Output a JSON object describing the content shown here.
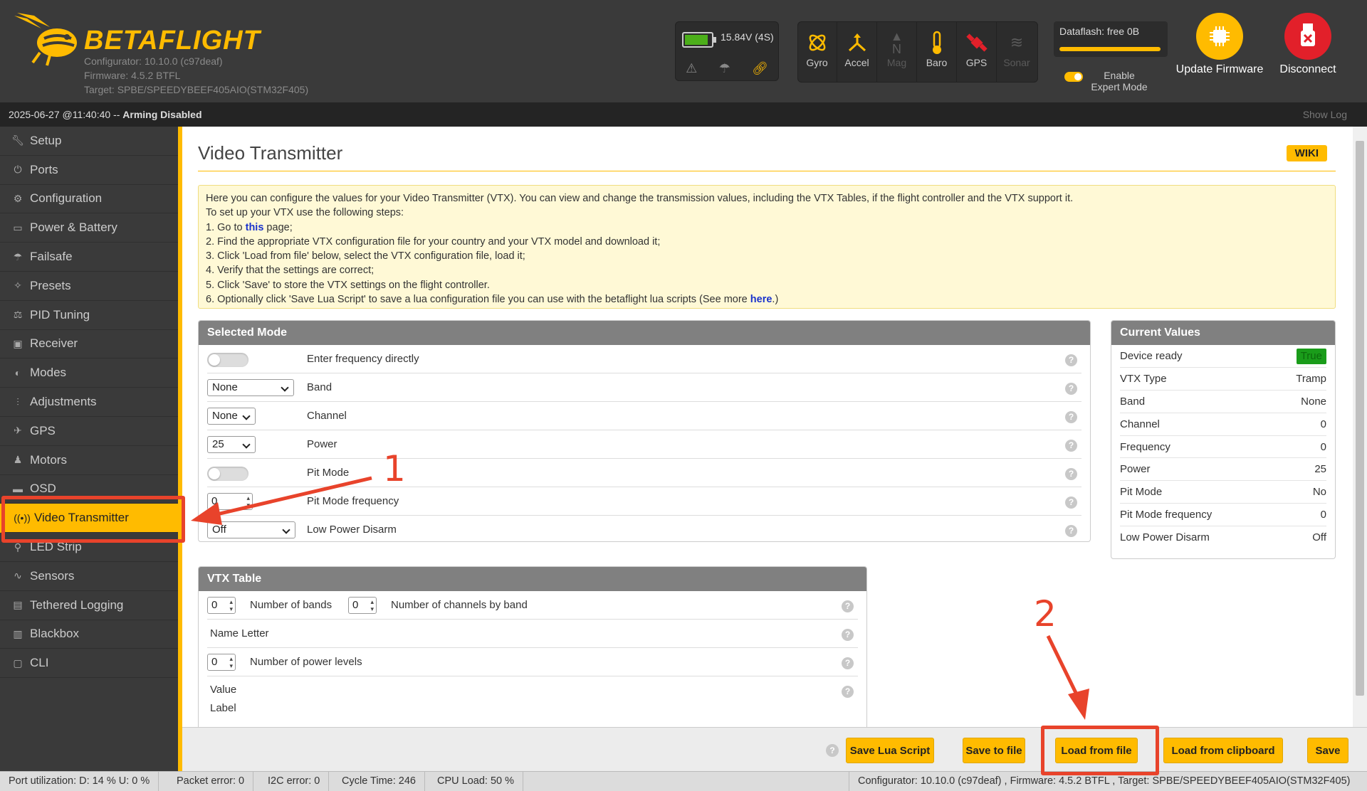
{
  "header": {
    "logo_text": "BETAFLIGHT",
    "configurator_version": "Configurator: 10.10.0 (c97deaf)",
    "firmware": "Firmware: 4.5.2 BTFL",
    "target": "Target: SPBE/SPEEDYBEEF405AIO(STM32F405)",
    "battery_voltage": "15.84V (4S)",
    "sensors": [
      {
        "label": "Gyro",
        "icon": "gyro-icon",
        "active": true
      },
      {
        "label": "Accel",
        "icon": "accel-icon",
        "active": true
      },
      {
        "label": "Mag",
        "icon": "mag-icon",
        "active": false
      },
      {
        "label": "Baro",
        "icon": "baro-icon",
        "active": true
      },
      {
        "label": "GPS",
        "icon": "gps-icon",
        "active": true
      },
      {
        "label": "Sonar",
        "icon": "sonar-icon",
        "active": false
      }
    ],
    "dataflash": "Dataflash: free 0B",
    "expert_mode_label": "Enable Expert Mode",
    "update_firmware_label": "Update Firmware",
    "disconnect_label": "Disconnect"
  },
  "status": {
    "datetime": "2025-06-27 @11:40:40",
    "separator": " -- ",
    "arming": "Arming Disabled",
    "show_log": "Show Log"
  },
  "sidebar": {
    "items": [
      {
        "label": "Setup",
        "icon": "wrench-icon"
      },
      {
        "label": "Ports",
        "icon": "plug-icon"
      },
      {
        "label": "Configuration",
        "icon": "gear-icon"
      },
      {
        "label": "Power & Battery",
        "icon": "battery-icon"
      },
      {
        "label": "Failsafe",
        "icon": "parachute-icon"
      },
      {
        "label": "Presets",
        "icon": "wand-icon"
      },
      {
        "label": "PID Tuning",
        "icon": "pid-icon"
      },
      {
        "label": "Receiver",
        "icon": "receiver-icon"
      },
      {
        "label": "Modes",
        "icon": "modes-icon"
      },
      {
        "label": "Adjustments",
        "icon": "sliders-icon"
      },
      {
        "label": "GPS",
        "icon": "satellite-icon"
      },
      {
        "label": "Motors",
        "icon": "motor-icon"
      },
      {
        "label": "OSD",
        "icon": "osd-icon"
      },
      {
        "label": "Video Transmitter",
        "icon": "vtx-icon",
        "active": true
      },
      {
        "label": "LED Strip",
        "icon": "led-icon"
      },
      {
        "label": "Sensors",
        "icon": "pulse-icon"
      },
      {
        "label": "Tethered Logging",
        "icon": "logging-icon"
      },
      {
        "label": "Blackbox",
        "icon": "blackbox-icon"
      },
      {
        "label": "CLI",
        "icon": "terminal-icon"
      }
    ]
  },
  "page": {
    "title": "Video Transmitter",
    "wiki_label": "WIKI",
    "note": {
      "line1": "Here you can configure the values for your Video Transmitter (VTX). You can view and change the transmission values, including the VTX Tables, if the flight controller and the VTX support it.",
      "line2": "To set up your VTX use the following steps:",
      "line3_pre": "1. Go to ",
      "line3_link": "this",
      "line3_post": " page;",
      "line4": "2. Find the appropriate VTX configuration file for your country and your VTX model and download it;",
      "line5": "3. Click 'Load from file' below, select the VTX configuration file, load it;",
      "line6": "4. Verify that the settings are correct;",
      "line7": "5. Click 'Save' to store the VTX settings on the flight controller.",
      "line8_pre": "6. Optionally click 'Save Lua Script' to save a lua configuration file you can use with the betaflight lua scripts (See more ",
      "line8_link": "here",
      "line8_post": ".)"
    }
  },
  "selected_mode": {
    "title": "Selected Mode",
    "rows": [
      {
        "label": "Enter frequency directly"
      },
      {
        "label": "Band",
        "value": "None"
      },
      {
        "label": "Channel",
        "value": "None"
      },
      {
        "label": "Power",
        "value": "25"
      },
      {
        "label": "Pit Mode"
      },
      {
        "label": "Pit Mode frequency",
        "value": "0"
      },
      {
        "label": "Low Power Disarm",
        "value": "Off"
      }
    ]
  },
  "current_values": {
    "title": "Current Values",
    "rows": [
      {
        "key": "Device ready",
        "value": "True"
      },
      {
        "key": "VTX Type",
        "value": "Tramp"
      },
      {
        "key": "Band",
        "value": "None"
      },
      {
        "key": "Channel",
        "value": "0"
      },
      {
        "key": "Frequency",
        "value": "0"
      },
      {
        "key": "Power",
        "value": "25"
      },
      {
        "key": "Pit Mode",
        "value": "No"
      },
      {
        "key": "Pit Mode frequency",
        "value": "0"
      },
      {
        "key": "Low Power Disarm",
        "value": "Off"
      }
    ]
  },
  "vtx_table": {
    "title": "VTX Table",
    "num_bands_value": "0",
    "num_bands_label": "Number of bands",
    "num_channels_value": "0",
    "num_channels_label": "Number of channels by band",
    "name_letter_label": "Name Letter",
    "num_power_value": "0",
    "num_power_label": "Number of power levels",
    "value_label": "Value",
    "label_label": "Label"
  },
  "footer": {
    "save_lua": "Save Lua Script",
    "save_file": "Save to file",
    "load_file": "Load from file",
    "load_clipboard": "Load from clipboard",
    "save": "Save"
  },
  "bottombar": {
    "port_util": "Port utilization: D: 14 % U: 0 %",
    "packet_error": "Packet error: 0",
    "i2c_error": "I2C error: 0",
    "cycle_time": "Cycle Time: 246",
    "cpu_load": "CPU Load: 50 %",
    "version": "Configurator: 10.10.0 (c97deaf) , Firmware: 4.5.2 BTFL , Target: SPBE/SPEEDYBEEF405AIO(STM32F405)"
  },
  "annotations": {
    "marker1": "1",
    "marker2": "2",
    "color": "#e8432b"
  },
  "colors": {
    "accent": "#ffbb00",
    "header_bg": "#3a3a3a",
    "disconnect": "#e2202a",
    "ready_green": "#1a9c1a"
  }
}
